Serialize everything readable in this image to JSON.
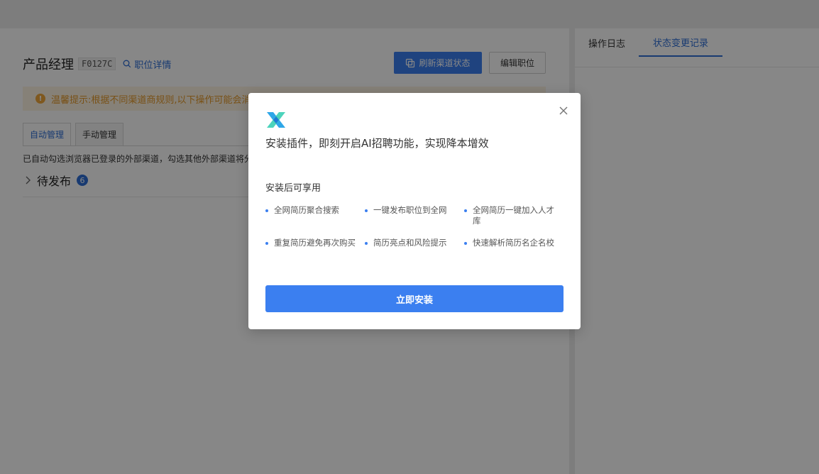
{
  "job": {
    "title": "产品经理",
    "code": "F0127C",
    "detail_link": "职位详情"
  },
  "toolbar": {
    "refresh_label": "刷新渠道状态",
    "edit_label": "编辑职位"
  },
  "warning": {
    "text": "温馨提示:根据不同渠道商规则,以下操作可能会消"
  },
  "tabs": [
    {
      "label": "自动管理",
      "active": true
    },
    {
      "label": "手动管理",
      "active": false
    }
  ],
  "auto_description": "已自动勾选浏览器已登录的外部渠道，勾选其他外部渠道将分",
  "pending_section": {
    "label": "待发布",
    "count": "6"
  },
  "side_panel": {
    "tabs": [
      {
        "label": "操作日志",
        "active": false
      },
      {
        "label": "状态变更记录",
        "active": true
      }
    ]
  },
  "modal": {
    "title": "安装插件，即刻开启AI招聘功能，实现降本增效",
    "subtitle": "安装后可享用",
    "features": [
      "全网简历聚合搜索",
      "一键发布职位到全网",
      "全网简历一键加入人才库",
      "重复简历避免再次购买",
      "简历亮点和风险提示",
      "快速解析简历名企名校"
    ],
    "install_label": "立即安装",
    "close_icon": "close-icon"
  },
  "colors": {
    "accent": "#3b7ff0",
    "link": "#2f6fd6",
    "warning_bg": "#fdf3e3",
    "warning_text": "#e49a2a"
  }
}
